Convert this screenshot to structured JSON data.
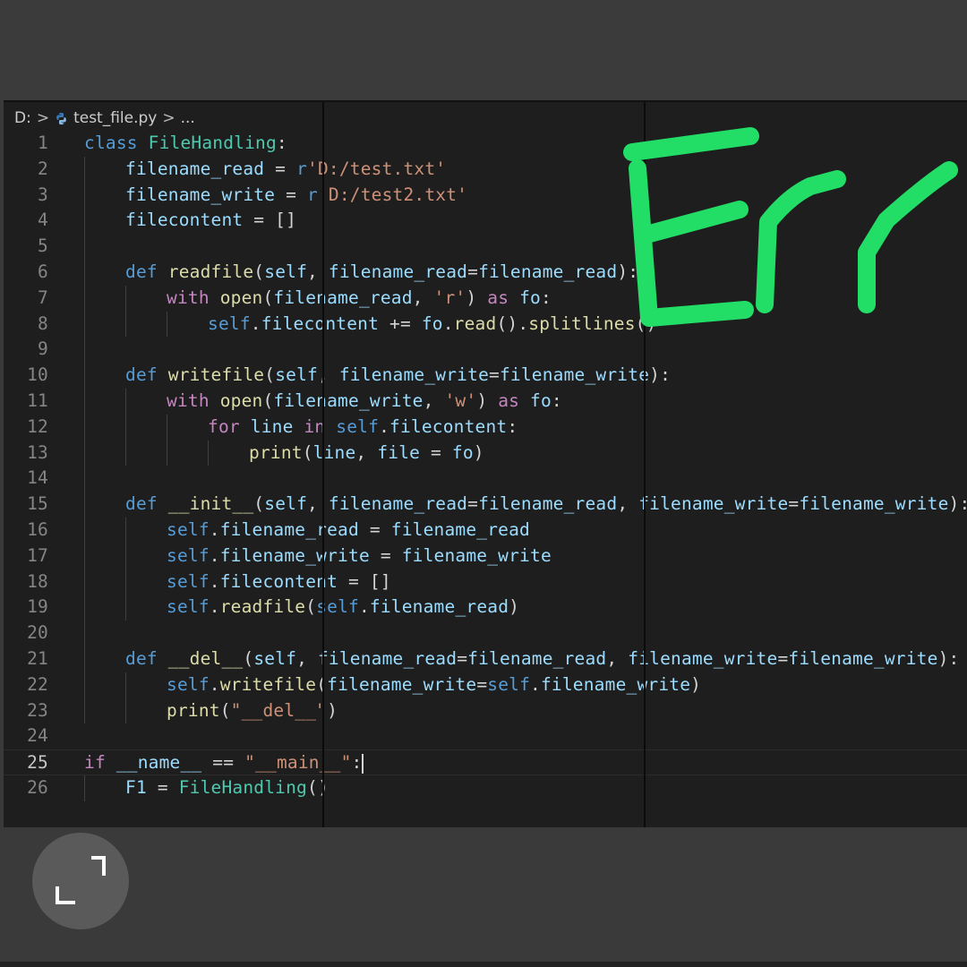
{
  "breadcrumb": {
    "drive": "D:",
    "sep": ">",
    "file": "test_file.py",
    "more": "..."
  },
  "lines": [
    {
      "num": "1",
      "indent": 0,
      "tokens": [
        [
          "class ",
          "kw"
        ],
        [
          "FileHandling",
          "cls"
        ],
        [
          ":",
          "plain"
        ]
      ]
    },
    {
      "num": "2",
      "indent": 1,
      "tokens": [
        [
          "filename_read",
          "var"
        ],
        [
          " = ",
          "plain"
        ],
        [
          "r",
          "kw"
        ],
        [
          "'D:/test.txt'",
          "str"
        ]
      ]
    },
    {
      "num": "3",
      "indent": 1,
      "tokens": [
        [
          "filename_write",
          "var"
        ],
        [
          " = ",
          "plain"
        ],
        [
          "r",
          "kw"
        ],
        [
          "'D:/test2.txt'",
          "str"
        ]
      ]
    },
    {
      "num": "4",
      "indent": 1,
      "tokens": [
        [
          "filecontent",
          "var"
        ],
        [
          " = []",
          "plain"
        ]
      ]
    },
    {
      "num": "5",
      "indent": 1,
      "tokens": []
    },
    {
      "num": "6",
      "indent": 1,
      "tokens": [
        [
          "def ",
          "kw"
        ],
        [
          "readfile",
          "fn"
        ],
        [
          "(",
          "plain"
        ],
        [
          "self",
          "var"
        ],
        [
          ", ",
          "plain"
        ],
        [
          "filename_read",
          "var"
        ],
        [
          "=",
          "plain"
        ],
        [
          "filename_read",
          "var"
        ],
        [
          "):",
          "plain"
        ]
      ]
    },
    {
      "num": "7",
      "indent": 2,
      "tokens": [
        [
          "with ",
          "kw2"
        ],
        [
          "open",
          "fn"
        ],
        [
          "(",
          "plain"
        ],
        [
          "filename_read",
          "var"
        ],
        [
          ", ",
          "plain"
        ],
        [
          "'r'",
          "str"
        ],
        [
          ") ",
          "plain"
        ],
        [
          "as ",
          "kw2"
        ],
        [
          "fo",
          "var"
        ],
        [
          ":",
          "plain"
        ]
      ]
    },
    {
      "num": "8",
      "indent": 3,
      "tokens": [
        [
          "self",
          "self"
        ],
        [
          ".",
          "plain"
        ],
        [
          "filecontent",
          "var"
        ],
        [
          " += ",
          "plain"
        ],
        [
          "fo",
          "var"
        ],
        [
          ".",
          "plain"
        ],
        [
          "read",
          "fn"
        ],
        [
          "().",
          "plain"
        ],
        [
          "splitlines",
          "fn"
        ],
        [
          "()",
          "plain"
        ]
      ]
    },
    {
      "num": "9",
      "indent": 1,
      "tokens": []
    },
    {
      "num": "10",
      "indent": 1,
      "tokens": [
        [
          "def ",
          "kw"
        ],
        [
          "writefile",
          "fn"
        ],
        [
          "(",
          "plain"
        ],
        [
          "self",
          "var"
        ],
        [
          ", ",
          "plain"
        ],
        [
          "filename_write",
          "var"
        ],
        [
          "=",
          "plain"
        ],
        [
          "filename_write",
          "var"
        ],
        [
          "):",
          "plain"
        ]
      ]
    },
    {
      "num": "11",
      "indent": 2,
      "tokens": [
        [
          "with ",
          "kw2"
        ],
        [
          "open",
          "fn"
        ],
        [
          "(",
          "plain"
        ],
        [
          "filename_write",
          "var"
        ],
        [
          ", ",
          "plain"
        ],
        [
          "'w'",
          "str"
        ],
        [
          ") ",
          "plain"
        ],
        [
          "as ",
          "kw2"
        ],
        [
          "fo",
          "var"
        ],
        [
          ":",
          "plain"
        ]
      ]
    },
    {
      "num": "12",
      "indent": 3,
      "tokens": [
        [
          "for ",
          "kw2"
        ],
        [
          "line",
          "var"
        ],
        [
          " in ",
          "kw2"
        ],
        [
          "self",
          "self"
        ],
        [
          ".",
          "plain"
        ],
        [
          "filecontent",
          "var"
        ],
        [
          ":",
          "plain"
        ]
      ]
    },
    {
      "num": "13",
      "indent": 4,
      "tokens": [
        [
          "print",
          "fn"
        ],
        [
          "(",
          "plain"
        ],
        [
          "line",
          "var"
        ],
        [
          ", ",
          "plain"
        ],
        [
          "file",
          "var"
        ],
        [
          " = ",
          "plain"
        ],
        [
          "fo",
          "var"
        ],
        [
          ")",
          "plain"
        ]
      ]
    },
    {
      "num": "14",
      "indent": 1,
      "tokens": []
    },
    {
      "num": "15",
      "indent": 1,
      "tokens": [
        [
          "def ",
          "kw"
        ],
        [
          "__init__",
          "fn"
        ],
        [
          "(",
          "plain"
        ],
        [
          "self",
          "var"
        ],
        [
          ", ",
          "plain"
        ],
        [
          "filename_read",
          "var"
        ],
        [
          "=",
          "plain"
        ],
        [
          "filename_read",
          "var"
        ],
        [
          ", ",
          "plain"
        ],
        [
          "filename_write",
          "var"
        ],
        [
          "=",
          "plain"
        ],
        [
          "filename_write",
          "var"
        ],
        [
          "):",
          "plain"
        ]
      ]
    },
    {
      "num": "16",
      "indent": 2,
      "tokens": [
        [
          "self",
          "self"
        ],
        [
          ".",
          "plain"
        ],
        [
          "filename_read",
          "var"
        ],
        [
          " = ",
          "plain"
        ],
        [
          "filename_read",
          "var"
        ]
      ]
    },
    {
      "num": "17",
      "indent": 2,
      "tokens": [
        [
          "self",
          "self"
        ],
        [
          ".",
          "plain"
        ],
        [
          "filename_write",
          "var"
        ],
        [
          " = ",
          "plain"
        ],
        [
          "filename_write",
          "var"
        ]
      ]
    },
    {
      "num": "18",
      "indent": 2,
      "tokens": [
        [
          "self",
          "self"
        ],
        [
          ".",
          "plain"
        ],
        [
          "filecontent",
          "var"
        ],
        [
          " = []",
          "plain"
        ]
      ]
    },
    {
      "num": "19",
      "indent": 2,
      "tokens": [
        [
          "self",
          "self"
        ],
        [
          ".",
          "plain"
        ],
        [
          "readfile",
          "fn"
        ],
        [
          "(",
          "plain"
        ],
        [
          "self",
          "self"
        ],
        [
          ".",
          "plain"
        ],
        [
          "filename_read",
          "var"
        ],
        [
          ")",
          "plain"
        ]
      ]
    },
    {
      "num": "20",
      "indent": 1,
      "tokens": []
    },
    {
      "num": "21",
      "indent": 1,
      "tokens": [
        [
          "def ",
          "kw"
        ],
        [
          "__del__",
          "fn"
        ],
        [
          "(",
          "plain"
        ],
        [
          "self",
          "var"
        ],
        [
          ", ",
          "plain"
        ],
        [
          "filename_read",
          "var"
        ],
        [
          "=",
          "plain"
        ],
        [
          "filename_read",
          "var"
        ],
        [
          ", ",
          "plain"
        ],
        [
          "filename_write",
          "var"
        ],
        [
          "=",
          "plain"
        ],
        [
          "filename_write",
          "var"
        ],
        [
          "):",
          "plain"
        ]
      ]
    },
    {
      "num": "22",
      "indent": 2,
      "tokens": [
        [
          "self",
          "self"
        ],
        [
          ".",
          "plain"
        ],
        [
          "writefile",
          "fn"
        ],
        [
          "(",
          "plain"
        ],
        [
          "filename_write",
          "var"
        ],
        [
          "=",
          "plain"
        ],
        [
          "self",
          "self"
        ],
        [
          ".",
          "plain"
        ],
        [
          "filename_write",
          "var"
        ],
        [
          ")",
          "plain"
        ]
      ]
    },
    {
      "num": "23",
      "indent": 2,
      "tokens": [
        [
          "print",
          "fn"
        ],
        [
          "(",
          "plain"
        ],
        [
          "\"__del__\"",
          "str"
        ],
        [
          ")",
          "plain"
        ]
      ]
    },
    {
      "num": "24",
      "indent": 0,
      "tokens": []
    },
    {
      "num": "25",
      "indent": 0,
      "active": true,
      "tokens": [
        [
          "if ",
          "kw2"
        ],
        [
          "__name__",
          "var"
        ],
        [
          " == ",
          "plain"
        ],
        [
          "\"__main__\"",
          "str"
        ],
        [
          ":",
          "plain"
        ]
      ]
    },
    {
      "num": "26",
      "indent": 1,
      "tokens": [
        [
          "F1",
          "var"
        ],
        [
          " = ",
          "plain"
        ],
        [
          "FileHandling",
          "cls"
        ],
        [
          "()",
          "plain"
        ]
      ]
    }
  ],
  "annotation": {
    "text": "Err",
    "color": "#22dd66"
  },
  "colors": {
    "editor_bg": "#1e1e1e",
    "band_bg": "#3a3a3a"
  }
}
